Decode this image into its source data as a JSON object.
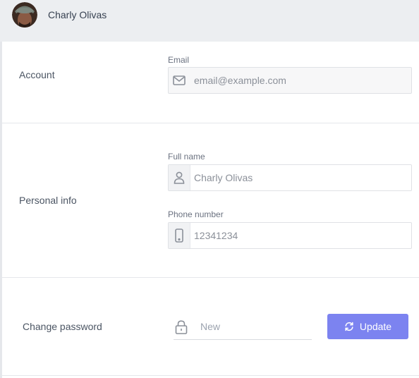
{
  "header": {
    "user_name": "Charly Olivas"
  },
  "sections": {
    "account": {
      "label": "Account",
      "email": {
        "label": "Email",
        "placeholder": "email@example.com",
        "icon": "mail-icon"
      }
    },
    "personal": {
      "label": "Personal info",
      "full_name": {
        "label": "Full name",
        "placeholder": "Charly Olivas",
        "icon": "user-icon"
      },
      "phone": {
        "label": "Phone number",
        "placeholder": "12341234",
        "icon": "phone-icon"
      }
    },
    "password": {
      "label": "Change password",
      "new_placeholder": "New",
      "icon": "lock-icon",
      "update_label": "Update",
      "update_icon": "refresh-icon"
    }
  },
  "colors": {
    "accent": "#7c83f0",
    "header_bg": "#eceef1"
  }
}
